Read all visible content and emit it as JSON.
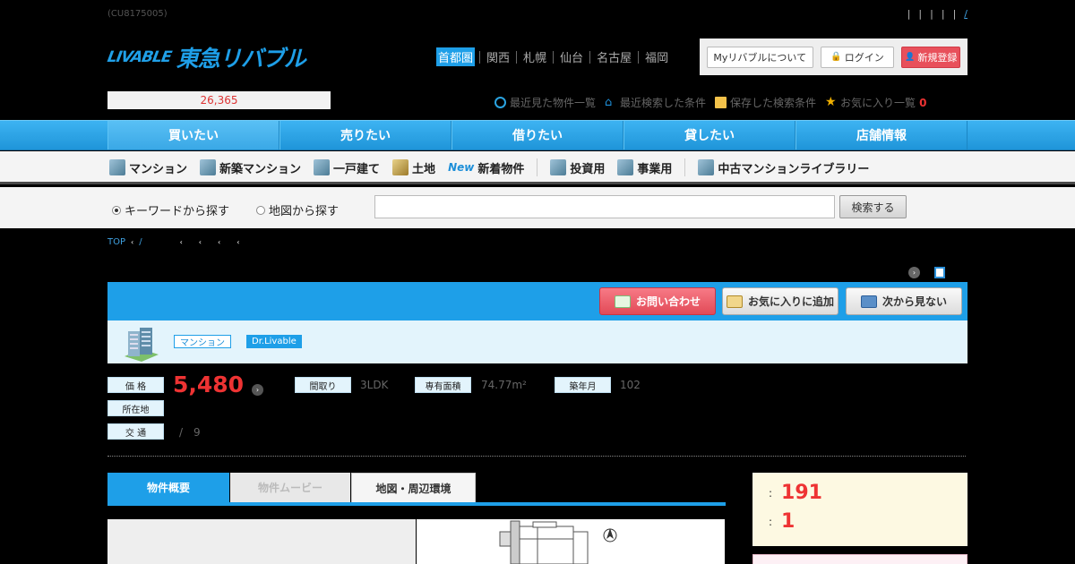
{
  "header": {
    "code": "(CU8175005)",
    "top_links": [
      "|",
      "|",
      "|",
      "|",
      "|",
      "/"
    ],
    "logo_mark": "LIVABLE",
    "logo_text": "東急リバブル",
    "regions": [
      "首都圏",
      "関西",
      "札幌",
      "仙台",
      "名古屋",
      "福岡"
    ],
    "active_region": "首都圏",
    "account": {
      "about_label": "MyリバブルについてMy",
      "about_display": "Myリバブルについて",
      "login_label": "ログイン",
      "register_label": "新規登録"
    },
    "counter": "26,365",
    "recent": {
      "viewed": "最近見た物件一覧",
      "searched": "最近検索した条件",
      "saved": "保存した検索条件",
      "favorites": "お気に入り一覧",
      "favorites_count": "0"
    }
  },
  "main_nav": [
    "買いたい",
    "売りたい",
    "借りたい",
    "貸したい",
    "店舗情報"
  ],
  "main_nav_active": "買いたい",
  "sub_nav": {
    "mansion": "マンション",
    "new_mansion": "新築マンション",
    "house": "一戸建て",
    "land": "土地",
    "new_tag": "New",
    "new_arrivals": "新着物件",
    "investment": "投資用",
    "business": "事業用",
    "library": "中古マンションライブラリー"
  },
  "search": {
    "keyword_option": "キーワードから探す",
    "map_option": "地図から探す",
    "keyword_value": "",
    "button": "検索する"
  },
  "breadcrumb": {
    "top": "TOP",
    "sep": "/"
  },
  "property": {
    "actions": {
      "contact": "お問い合わせ",
      "favorite": "お気に入りに追加",
      "hide": "次から見ない"
    },
    "tags": [
      "マンション",
      "Dr.Livable"
    ],
    "labels": {
      "price": "価 格",
      "layout": "間取り",
      "area": "専有面積",
      "built": "築年月",
      "address": "所在地",
      "transit": "交 通"
    },
    "price": "5,480",
    "layout": "3LDK",
    "area": "74.77m²",
    "built": "102",
    "transit_sep": "/",
    "transit_value": "9"
  },
  "tabs": [
    "物件概要",
    "物件ムービー",
    "地図・周辺環境"
  ],
  "sidebox": {
    "row1_colon": ":",
    "row1_value": "191",
    "row2_colon": ":",
    "row2_value": "1"
  },
  "colors": {
    "brand_blue": "#1e9fe8",
    "accent_red": "#e33333",
    "contact_pink": "#e24a57",
    "side_bg": "#fdf9e2"
  }
}
